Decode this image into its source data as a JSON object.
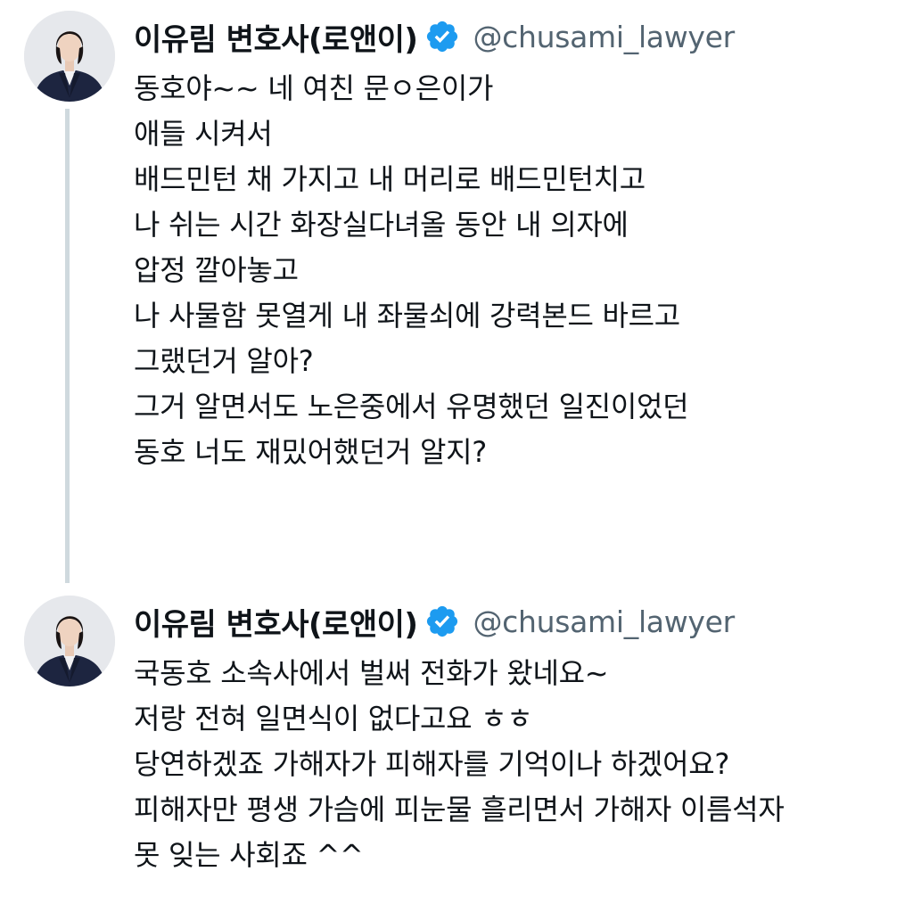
{
  "tweets": [
    {
      "author": {
        "name": "이유림 변호사(로앤이)",
        "handle": "@chusami_lawyer",
        "verified_icon": "verified-badge-icon"
      },
      "lines": [
        "동호야~~ 네 여친 문ㅇ은이가",
        "애들 시켜서",
        "배드민턴 채 가지고 내 머리로 배드민턴치고",
        "나 쉬는 시간 화장실다녀올 동안 내 의자에",
        "압정 깔아놓고",
        "나 사물함 못열게 내 좌물쇠에 강력본드 바르고",
        "그랬던거 알아?",
        "그거 알면서도 노은중에서 유명했던 일진이었던",
        "동호 너도 재밌어했던거 알지?"
      ]
    },
    {
      "author": {
        "name": "이유림 변호사(로앤이)",
        "handle": "@chusami_lawyer",
        "verified_icon": "verified-badge-icon"
      },
      "lines": [
        "국동호 소속사에서 벌써 전화가 왔네요~",
        "저랑 전혀 일면식이 없다고요 ㅎㅎ",
        "당연하겠죠 가해자가 피해자를 기억이나 하겠어요?",
        "피해자만 평생 가슴에 피눈물 흘리면서 가해자 이름석자",
        "못 잊는 사회죠 ^^"
      ]
    }
  ],
  "colors": {
    "verified": "#1d9bf0",
    "handle": "#536471",
    "text": "#0f1419",
    "thread_line": "#cfd9de"
  }
}
